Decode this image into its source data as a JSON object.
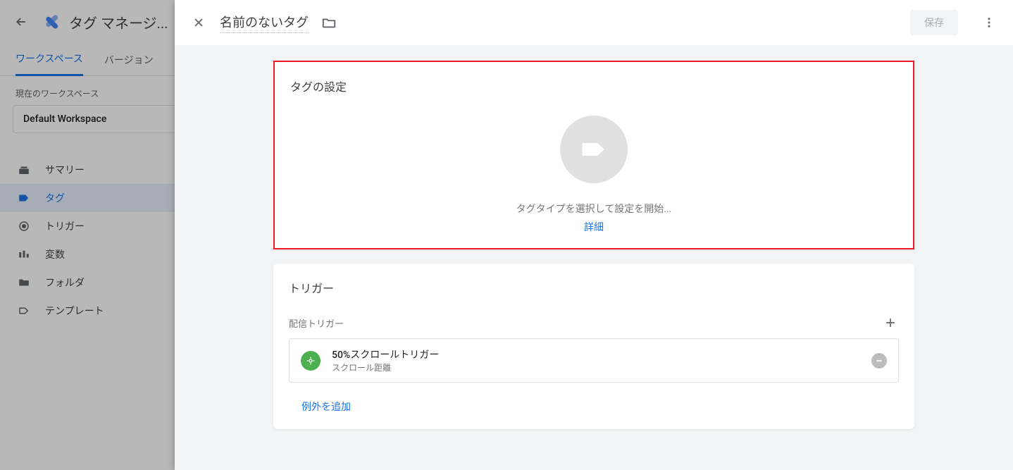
{
  "bg": {
    "title": "タグ マネージ...",
    "tabs": {
      "workspace": "ワークスペース",
      "versions": "バージョン"
    },
    "ws_label": "現在のワークスペース",
    "ws_name": "Default Workspace",
    "nav": {
      "summary": "サマリー",
      "tags": "タグ",
      "triggers": "トリガー",
      "variables": "変数",
      "folders": "フォルダ",
      "templates": "テンプレート"
    }
  },
  "panel": {
    "title": "名前のないタグ",
    "save": "保存",
    "tag_config": {
      "heading": "タグの設定",
      "prompt": "タグタイプを選択して設定を開始...",
      "detail": "詳細"
    },
    "triggers": {
      "heading": "トリガー",
      "sub": "配信トリガー",
      "item": {
        "name": "50%スクロールトリガー",
        "type": "スクロール距離"
      },
      "add_exception": "例外を追加"
    }
  }
}
